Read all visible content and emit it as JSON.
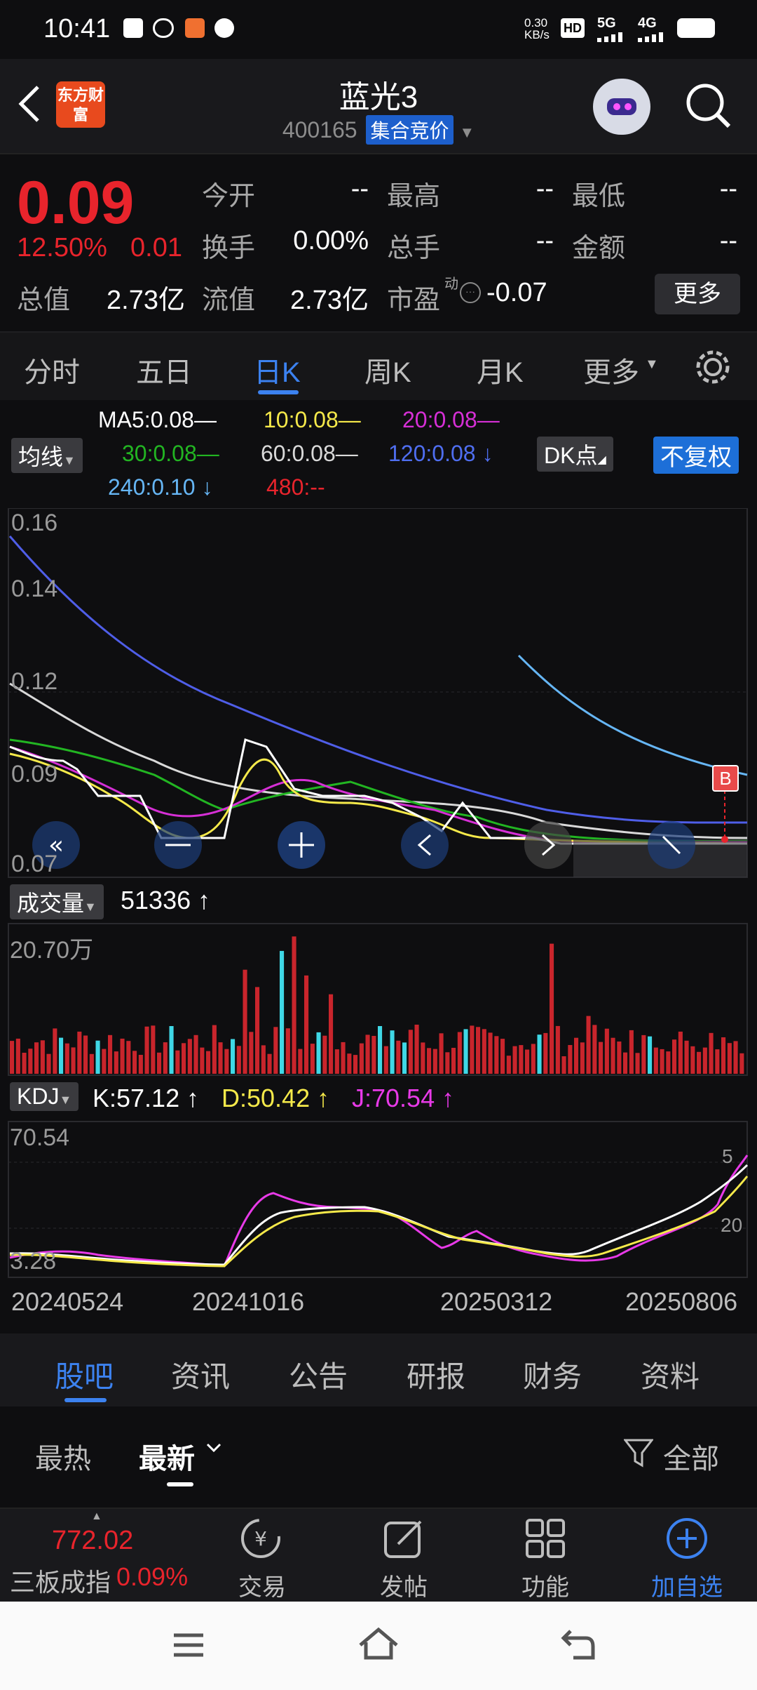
{
  "status_bar": {
    "time": "10:41",
    "net_speed": "0.30 KB/s",
    "signal1": "5G",
    "signal2": "4G"
  },
  "header": {
    "title": "蓝光3",
    "code": "400165",
    "badge": "集合竞价",
    "logo_text": "东方财富"
  },
  "quote": {
    "price": "0.09",
    "change_pct": "12.50%",
    "change_amt": "0.01",
    "fields": [
      {
        "label": "今开",
        "value": "--"
      },
      {
        "label": "最高",
        "value": "--"
      },
      {
        "label": "最低",
        "value": "--"
      },
      {
        "label": "换手",
        "value": "0.00%"
      },
      {
        "label": "总手",
        "value": "--"
      },
      {
        "label": "金额",
        "value": "--"
      },
      {
        "label": "总值",
        "value": "2.73亿"
      },
      {
        "label": "流值",
        "value": "2.73亿"
      },
      {
        "label": "市盈",
        "sup": "动",
        "value": "-0.07"
      }
    ],
    "more_label": "更多"
  },
  "kline_tabs": [
    {
      "label": "分时"
    },
    {
      "label": "五日"
    },
    {
      "label": "日K"
    },
    {
      "label": "周K"
    },
    {
      "label": "月K"
    },
    {
      "label": "更多"
    }
  ],
  "indicators": {
    "ma_button": "均线",
    "ma5": "MA5:0.08—",
    "ma10": "10:0.08—",
    "ma20": "20:0.08—",
    "ma30": "30:0.08—",
    "ma60": "60:0.08—",
    "ma120": "120:0.08 ↓",
    "ma240": "240:0.10 ↓",
    "ma480": "480:--",
    "dk_button": "DK点",
    "fq_button": "不复权",
    "colors": {
      "ma5": "#ffffff",
      "ma10": "#f5e94a",
      "ma20": "#d62fd6",
      "ma30": "#22b522",
      "ma60": "#d9d9d9",
      "ma120": "#4f5ee8",
      "ma240": "#66b6f5",
      "ma480": "#e8242c"
    }
  },
  "price_chart": {
    "y_ticks": [
      "0.16",
      "0.14",
      "0.12",
      "0.09",
      "0.07"
    ],
    "marker": "B"
  },
  "volume": {
    "button": "成交量",
    "value": "51336 ↑",
    "max_label": "20.70万"
  },
  "kdj": {
    "button": "KDJ",
    "k": "K:57.12 ↑",
    "d": "D:50.42 ↑",
    "j": "J:70.54 ↑",
    "top_label": "70.54",
    "bottom_label": "3.28",
    "r1": "5",
    "r2": "20"
  },
  "dates": [
    "20240524",
    "20241016",
    "20250312",
    "20250806"
  ],
  "section_tabs": [
    {
      "label": "股吧"
    },
    {
      "label": "资讯"
    },
    {
      "label": "公告"
    },
    {
      "label": "研报"
    },
    {
      "label": "财务"
    },
    {
      "label": "资料"
    }
  ],
  "filters": {
    "hot": "最热",
    "latest": "最新",
    "all": "全部"
  },
  "bottom_nav": {
    "index_value": "772.02",
    "index_name": "三板成指",
    "index_pct": "0.09%",
    "items": [
      {
        "label": "交易"
      },
      {
        "label": "发帖"
      },
      {
        "label": "功能"
      },
      {
        "label": "加自选"
      }
    ]
  }
}
